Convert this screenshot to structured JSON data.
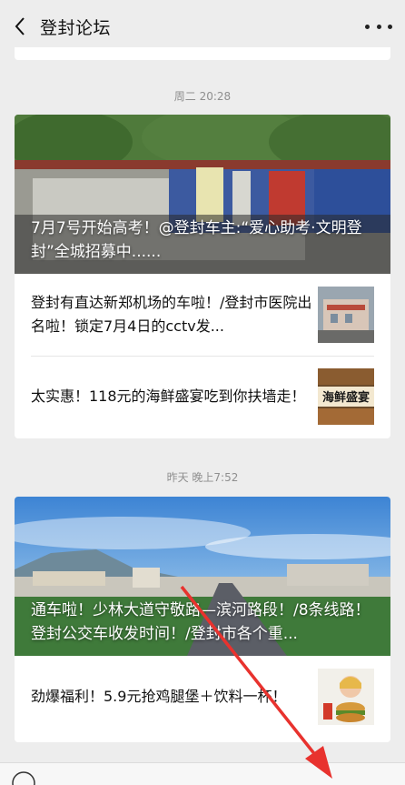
{
  "header": {
    "title": "登封论坛"
  },
  "feed": [
    {
      "time": "周二 20:28",
      "hero_title": "7月7号开始高考！@登封车主:“爱心助考·文明登封”全城招募中......",
      "items": [
        {
          "title": "登封有直达新郑机场的车啦！/登封市医院出名啦！锁定7月4日的cctv发...",
          "thumb": "hospital-thumbnail"
        },
        {
          "title": "太实惠！118元的海鲜盛宴吃到你扶墙走！",
          "thumb": "seafood-thumbnail",
          "thumb_text": "海鲜盛宴"
        }
      ]
    },
    {
      "time": "昨天 晚上7:52",
      "hero_title": "通车啦！少林大道守敬路—滨河路段！/8条线路！登封公交车收发时间！/登封市各个重...",
      "items": [
        {
          "title": "劲爆福利！5.9元抢鸡腿堡＋饮料一杯！",
          "thumb": "burger-thumbnail"
        }
      ]
    }
  ],
  "annotation": {
    "type": "red-arrow",
    "color": "#e8322e"
  },
  "colors": {
    "background": "#ededed",
    "card": "#ffffff",
    "muted": "#8f8f8f"
  }
}
